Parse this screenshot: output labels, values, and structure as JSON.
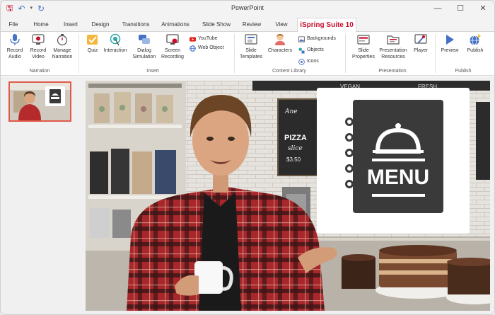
{
  "app": {
    "title": "PowerPoint"
  },
  "titlebar": {
    "minimize": "—",
    "maximize": "☐",
    "close": "✕",
    "save_glyph": "🖫",
    "undo_glyph": "↶",
    "undo_caret": "▾",
    "redo_glyph": "↻"
  },
  "tabs": [
    "File",
    "Home",
    "Insert",
    "Design",
    "Transitions",
    "Animations",
    "Slide Show",
    "Review",
    "View",
    "iSpring Suite 10"
  ],
  "active_tab": "iSpring Suite 10",
  "ribbon": {
    "narration": {
      "label": "Narration",
      "record_audio": [
        "Record",
        "Audio"
      ],
      "record_video": [
        "Record",
        "Video"
      ],
      "manage_narration": [
        "Manage",
        "Narration"
      ]
    },
    "insert": {
      "label": "Insert",
      "quiz": "Quiz",
      "interaction": "Interaction",
      "dialog_simulation": [
        "Dialog",
        "Simulation"
      ],
      "screen_recording": [
        "Screen",
        "Recording"
      ],
      "youtube": "YouTube",
      "web_object": "Web Object"
    },
    "content_library": {
      "label": "Content Library",
      "slide_templates": [
        "Slide",
        "Templates"
      ],
      "characters": "Characters",
      "backgrounds": "Backgrounds",
      "objects": "Objects",
      "icons": "Icons"
    },
    "presentation": {
      "label": "Presentation",
      "slide_properties": [
        "Slide",
        "Properties"
      ],
      "presentation_resources": [
        "Presentation",
        "Resources"
      ],
      "player": "Player"
    },
    "publish": {
      "label": "Publish",
      "preview": "Preview",
      "publish": "Publish"
    }
  },
  "slide": {
    "menu_word": "MENU",
    "chalkboard_top": "Ane",
    "chalkboard_main": "PIZZA",
    "chalkboard_sub": "slice",
    "chalkboard_price": "$3.50",
    "top_board_1": "VEGAN",
    "top_board_2": "FRESH"
  },
  "colors": {
    "accent": "#c8102e",
    "icon_blue": "#4472c4",
    "menu_dark": "#3a3a3a"
  }
}
